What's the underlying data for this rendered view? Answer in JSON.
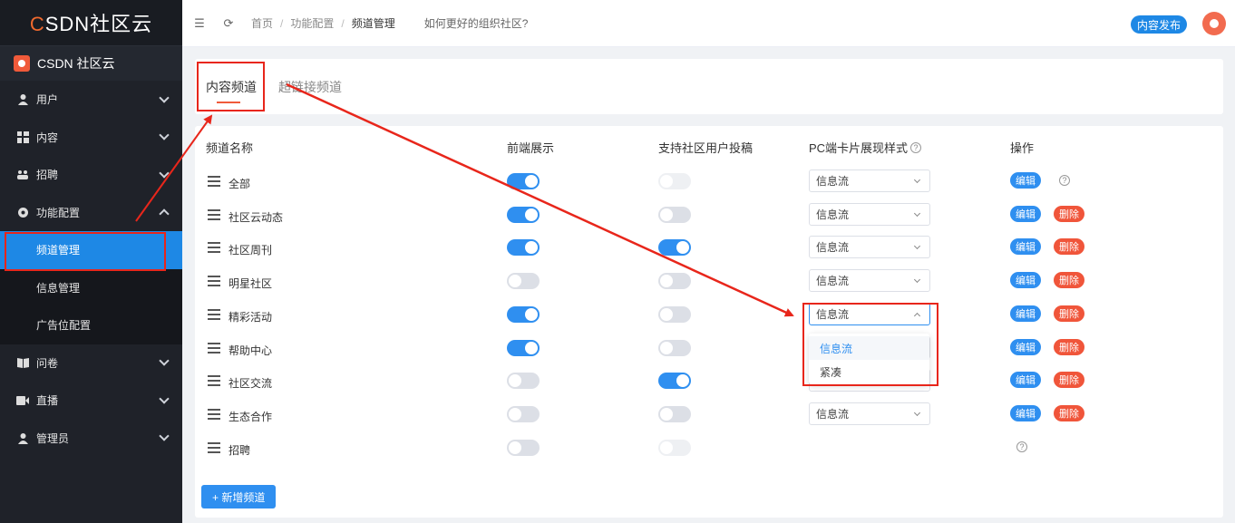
{
  "sidebar": {
    "logo_prefix": "C",
    "logo_rest": "SDN社区云",
    "org": "CSDN 社区云",
    "menu": [
      {
        "label": "用户",
        "icon": "user-icon"
      },
      {
        "label": "内容",
        "icon": "content-icon"
      },
      {
        "label": "招聘",
        "icon": "group-icon"
      },
      {
        "label": "功能配置",
        "icon": "gear-icon"
      },
      {
        "label": "问卷",
        "icon": "book-icon"
      },
      {
        "label": "直播",
        "icon": "video-icon"
      },
      {
        "label": "管理员",
        "icon": "admin-icon"
      }
    ],
    "sub": [
      "频道管理",
      "信息管理",
      "广告位配置"
    ]
  },
  "header": {
    "crumbs": [
      "首页",
      "功能配置",
      "频道管理"
    ],
    "question": "如何更好的组织社区?",
    "publish": "内容发布"
  },
  "tabs": [
    "内容频道",
    "超链接频道"
  ],
  "table": {
    "headers": [
      "频道名称",
      "前端展示",
      "支持社区用户投稿",
      "PC端卡片展现样式",
      "操作"
    ],
    "help_mark": "?",
    "edit_label": "编辑",
    "delete_label": "删除",
    "rows": [
      {
        "name": "全部",
        "front": true,
        "submit": false,
        "submit_disabled": true,
        "style": "信息流",
        "edit": true,
        "del": false,
        "help": true
      },
      {
        "name": "社区云动态",
        "front": true,
        "submit": false,
        "submit_disabled": false,
        "style": "信息流",
        "edit": true,
        "del": true,
        "help": false
      },
      {
        "name": "社区周刊",
        "front": true,
        "submit": true,
        "submit_disabled": false,
        "style": "信息流",
        "edit": true,
        "del": true,
        "help": false
      },
      {
        "name": "明星社区",
        "front": false,
        "submit": false,
        "submit_disabled": false,
        "style": "信息流",
        "edit": true,
        "del": true,
        "help": false
      },
      {
        "name": "精彩活动",
        "front": true,
        "submit": false,
        "submit_disabled": false,
        "style": "信息流",
        "edit": true,
        "del": true,
        "help": false,
        "open": true
      },
      {
        "name": "帮助中心",
        "front": true,
        "submit": false,
        "submit_disabled": false,
        "style": "信息流",
        "edit": true,
        "del": true,
        "help": false
      },
      {
        "name": "社区交流",
        "front": false,
        "submit": true,
        "submit_disabled": false,
        "style": "信息流",
        "edit": true,
        "del": true,
        "help": false
      },
      {
        "name": "生态合作",
        "front": false,
        "submit": false,
        "submit_disabled": false,
        "style": "信息流",
        "edit": true,
        "del": true,
        "help": false
      },
      {
        "name": "招聘",
        "front": false,
        "submit": false,
        "submit_disabled": true,
        "style": "",
        "edit": false,
        "del": false,
        "help": true
      }
    ],
    "dropdown_options": [
      "信息流",
      "紧凑"
    ],
    "add_label": "+ 新增频道"
  }
}
